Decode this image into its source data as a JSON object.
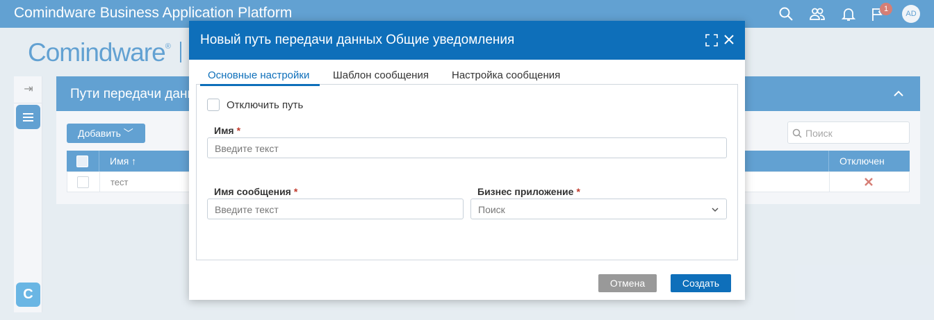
{
  "app": {
    "title": "Comindware Business Application Platform",
    "notification_count": "1",
    "avatar_initials": "AD",
    "brand_color": "#0e6fba"
  },
  "logo": {
    "text": "Comindware",
    "reg": "®"
  },
  "page": {
    "title": "Пути передачи данных",
    "add_button_label": "Добавить",
    "search_placeholder": "Поиск",
    "table": {
      "columns": [
        "Имя ↑",
        "Отключен"
      ],
      "rows": [
        {
          "name": "тест",
          "disabled_icon": "x-mark-icon"
        }
      ]
    }
  },
  "modal": {
    "title": "Новый путь передачи данных Общие уведомления",
    "tabs": [
      "Основные настройки",
      "Шаблон сообщения",
      "Настройка сообщения"
    ],
    "active_tab": "Основные настройки",
    "disable_path_label": "Отключить путь",
    "disable_path_checked": false,
    "fields": {
      "name": {
        "label": "Имя",
        "required_mark": "*",
        "placeholder": "Введите текст",
        "value": ""
      },
      "message_name": {
        "label": "Имя сообщения",
        "required_mark": "*",
        "placeholder": "Введите текст",
        "value": ""
      },
      "business_app": {
        "label": "Бизнес приложение",
        "required_mark": "*",
        "placeholder": "Поиск",
        "value": ""
      }
    },
    "cancel_label": "Отмена",
    "create_label": "Создать"
  }
}
